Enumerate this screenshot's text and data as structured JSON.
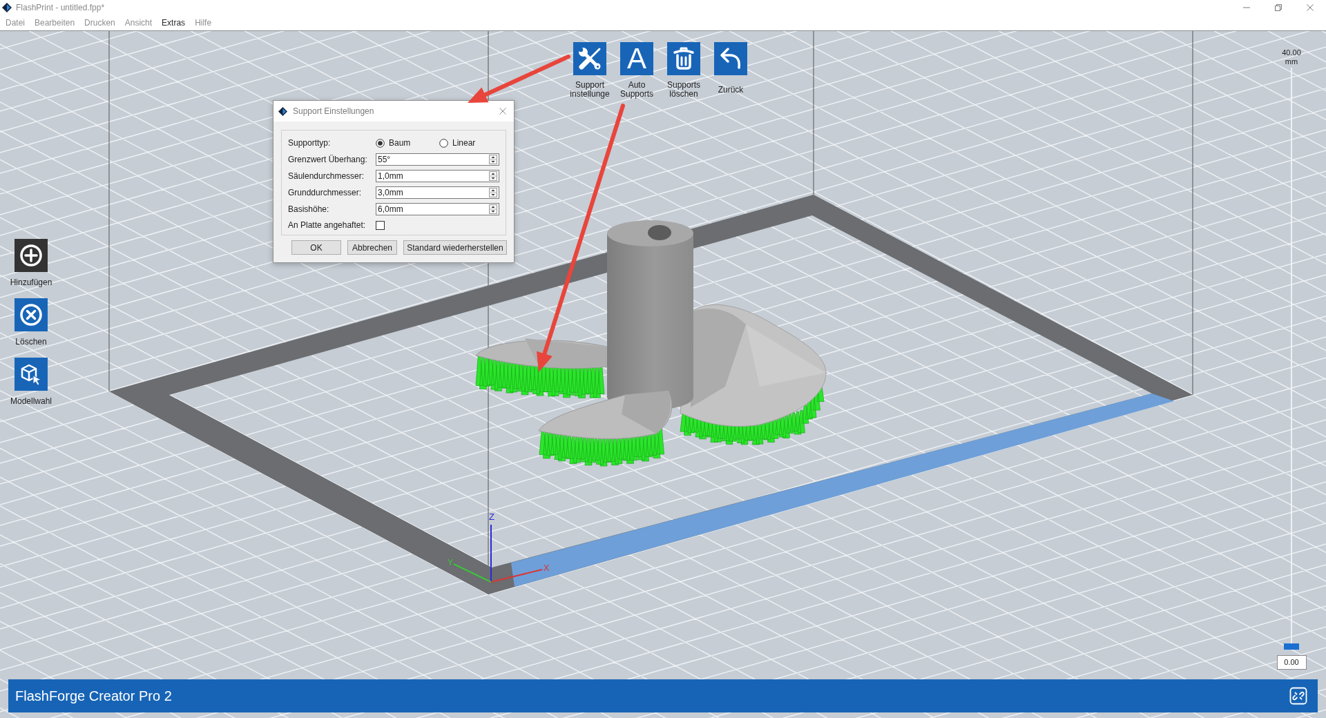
{
  "window": {
    "title": "FlashPrint - untitled.fpp*"
  },
  "menu": [
    {
      "label": "Datei",
      "active": false
    },
    {
      "label": "Bearbeiten",
      "active": false
    },
    {
      "label": "Drucken",
      "active": false
    },
    {
      "label": "Ansicht",
      "active": false
    },
    {
      "label": "Extras",
      "active": true
    },
    {
      "label": "Hilfe",
      "active": false
    }
  ],
  "toolbar": [
    {
      "kind": "settings",
      "label": "Support instellunge"
    },
    {
      "kind": "auto",
      "glyph": "A",
      "label": "Auto Supports"
    },
    {
      "kind": "delete",
      "label": "Supports löschen"
    },
    {
      "kind": "back",
      "label": "Zurück"
    }
  ],
  "side_tools": [
    {
      "kind": "add",
      "label": "Hinzufügen",
      "highlighted": true
    },
    {
      "kind": "delete",
      "label": "Löschen",
      "highlighted": false
    },
    {
      "kind": "select",
      "label": "Modellwahl",
      "highlighted": false
    }
  ],
  "dialog": {
    "title": "Support Einstellungen",
    "rows": [
      {
        "kind": "radio",
        "label": "Supporttyp:",
        "options": [
          {
            "label": "Baum",
            "selected": true
          },
          {
            "label": "Linear",
            "selected": false
          }
        ]
      },
      {
        "kind": "spin",
        "label": "Grenzwert Überhang:",
        "value": "55°"
      },
      {
        "kind": "spin",
        "label": "Säulendurchmesser:",
        "value": "1,0mm"
      },
      {
        "kind": "spin",
        "label": "Grunddurchmesser:",
        "value": "3,0mm"
      },
      {
        "kind": "spin",
        "label": "Basishöhe:",
        "value": "6,0mm"
      },
      {
        "kind": "checkbox",
        "label": "An Platte angehaftet:",
        "checked": false
      }
    ],
    "buttons": [
      "OK",
      "Abbrechen",
      "Standard wiederherstellen"
    ]
  },
  "height_slider": {
    "top_label": "40.00",
    "unit": "mm",
    "level": 0,
    "value": "0.00"
  },
  "axes": [
    {
      "kind": "z",
      "label": "Z",
      "color": "#2a2ad6"
    },
    {
      "kind": "y",
      "label": "Y",
      "color": "#3ec23e"
    },
    {
      "kind": "x",
      "label": "X",
      "color": "#d93636"
    }
  ],
  "status_bar": {
    "printer": "FlashForge Creator Pro 2"
  }
}
